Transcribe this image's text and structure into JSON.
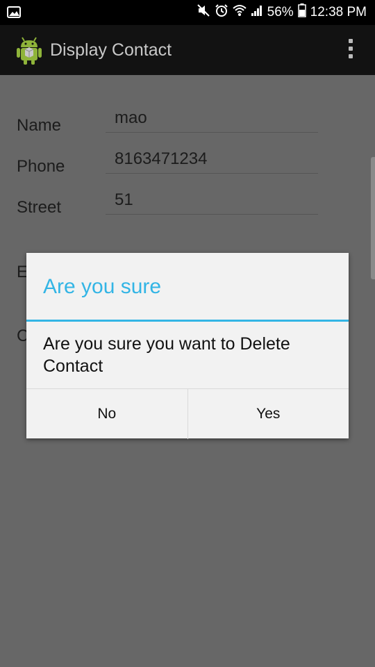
{
  "status_bar": {
    "battery": "56%",
    "time": "12:38 PM",
    "icons": [
      "image-notification-icon",
      "mute-icon",
      "alarm-icon",
      "wifi-icon",
      "signal-icon",
      "battery-icon"
    ]
  },
  "action_bar": {
    "title": "Display Contact",
    "icon": "android-icon",
    "menu_icon": "overflow-menu-icon"
  },
  "form": {
    "rows": [
      {
        "label": "Name",
        "value": "mao"
      },
      {
        "label": "Phone",
        "value": "8163471234"
      },
      {
        "label": "Street",
        "value": "51"
      }
    ],
    "partial_labels": [
      "E",
      "C"
    ]
  },
  "dialog": {
    "title": "Are you sure",
    "message": "Are you sure you want to Delete Contact",
    "no_label": "No",
    "yes_label": "Yes"
  },
  "colors": {
    "accent": "#33b5e5",
    "dim_background": "#676767",
    "dialog_background": "#f2f2f2"
  }
}
